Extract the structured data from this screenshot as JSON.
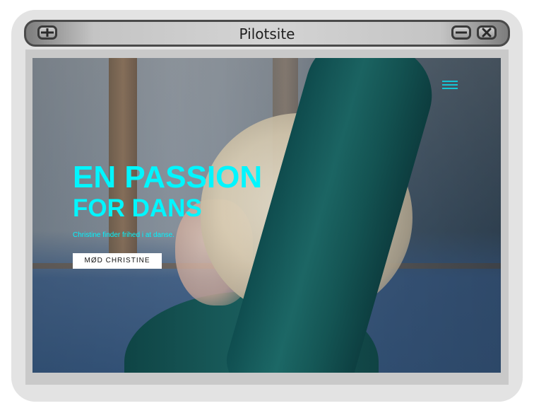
{
  "window": {
    "title": "Pilotsite",
    "buttons": {
      "add_icon": "plus-icon",
      "minimize_icon": "minus-icon",
      "close_icon": "close-icon"
    }
  },
  "page": {
    "menu_icon": "hamburger-menu-icon",
    "hero": {
      "title_line_1": "EN PASSION",
      "title_line_2": "FOR DANS",
      "subtitle": "Christine finder frihed i at danse.",
      "cta_label": "MØD CHRISTINE"
    },
    "background_image": "dancer-photo"
  },
  "colors": {
    "accent": "#00f6ff",
    "menu_icon": "#15c6d6",
    "cta_background": "#ffffff",
    "cta_text": "#111111"
  }
}
